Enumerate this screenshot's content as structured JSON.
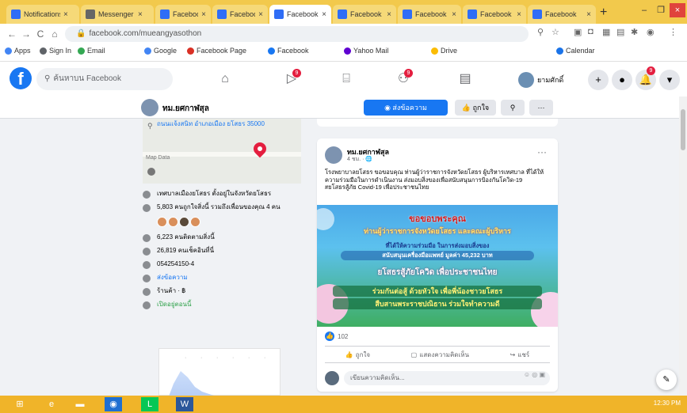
{
  "browser": {
    "tabs": [
      {
        "label": "Notifications"
      },
      {
        "label": "Messenger"
      },
      {
        "label": "Facebook"
      },
      {
        "label": "Facebook"
      },
      {
        "label": "Facebook"
      },
      {
        "label": "Facebook"
      },
      {
        "label": "Facebook"
      },
      {
        "label": "Facebook"
      },
      {
        "label": "Facebook"
      }
    ],
    "url": "facebook.com/mueangyasothon"
  },
  "bookmarks": [
    {
      "label": "Apps"
    },
    {
      "label": "Sign In"
    },
    {
      "label": "Email"
    },
    {
      "label": "Google"
    },
    {
      "label": "Facebook Page"
    },
    {
      "label": "Facebook"
    },
    {
      "label": "Yahoo Mail"
    },
    {
      "label": "Drive"
    },
    {
      "label": "Calendar"
    }
  ],
  "fb": {
    "search_placeholder": "ค้นหาบน Facebook",
    "profile_name": "ยามศักดิ์",
    "badges": {
      "watch": "9",
      "marketplace": "9",
      "notifications": "9"
    }
  },
  "page": {
    "name": "ทม.ยศกาฬสุล",
    "contact_button": "ส่งข้อความ",
    "like_button": "ถูกใจ"
  },
  "about": {
    "address": "ถนนแจ้งสนิท อำเภอเมือง ยโสธร 35000",
    "map_label": "Map Data",
    "items": [
      {
        "text": "เทศบาลเมืองยโสธร ตั้งอยู่ในจังหวัดยโสธร"
      },
      {
        "text": "5,803 คนถูกใจสิ่งนี้ รวมถึงเพื่อนของคุณ 4 คน"
      },
      {
        "text": "6,223 คนติดตามสิ่งนี้"
      },
      {
        "text": "26,819 คนเช็คอินที่นี่"
      },
      {
        "text": "054254150-4"
      },
      {
        "text": "ส่งข้อความ"
      },
      {
        "text": "ร้านค้า · ฿"
      },
      {
        "text": "เปิดอยู่ตอนนี้"
      }
    ]
  },
  "post": {
    "author": "ทม.ยศกาฬสุล",
    "time": "4 ชม. · 🌐",
    "text": "โรงพยาบาลยโสธร ขอขอบคุณ ท่านผู้ว่าราชการจังหวัดยโสธร ผู้บริหารเทศบาล ที่ได้ให้ความร่วมมือในการดำเนินงาน ส่งมอบสิ่งของเพื่อสนับสนุนการป้องกันโควิด-19",
    "hashtags": "#ยโสธรสู้ภัย Covid-19 เพื่อประชาชนไทย",
    "banner": {
      "line1": "ขอขอบพระคุณ",
      "line2": "ท่านผู้ว่าราชการจังหวัดยโสธร และคณะผู้บริหาร",
      "line3": "ที่ได้ให้ความร่วมมือ ในการส่งมอบสิ่งของ",
      "line4": "สนับสนุนเครื่องมือแพทย์ มูลค่า 45,232 บาท",
      "line5": "ยโสธรสู้ภัยโควิด เพื่อประชาชนไทย",
      "line6": "ร่วมกันต่อสู้ ด้วยหัวใจ เพื่อพี่น้องชาวยโสธร",
      "line7": "สืบสานพระราชปณิธาน ร่วมใจทำความดี"
    },
    "reactions_count": "102",
    "like_action": "ถูกใจ",
    "comment_action": "แสดงความคิดเห็น",
    "share_action": "แชร์",
    "comment_placeholder": "เขียนความคิดเห็น..."
  },
  "taskbar": {
    "clock": "12:30 PM"
  }
}
